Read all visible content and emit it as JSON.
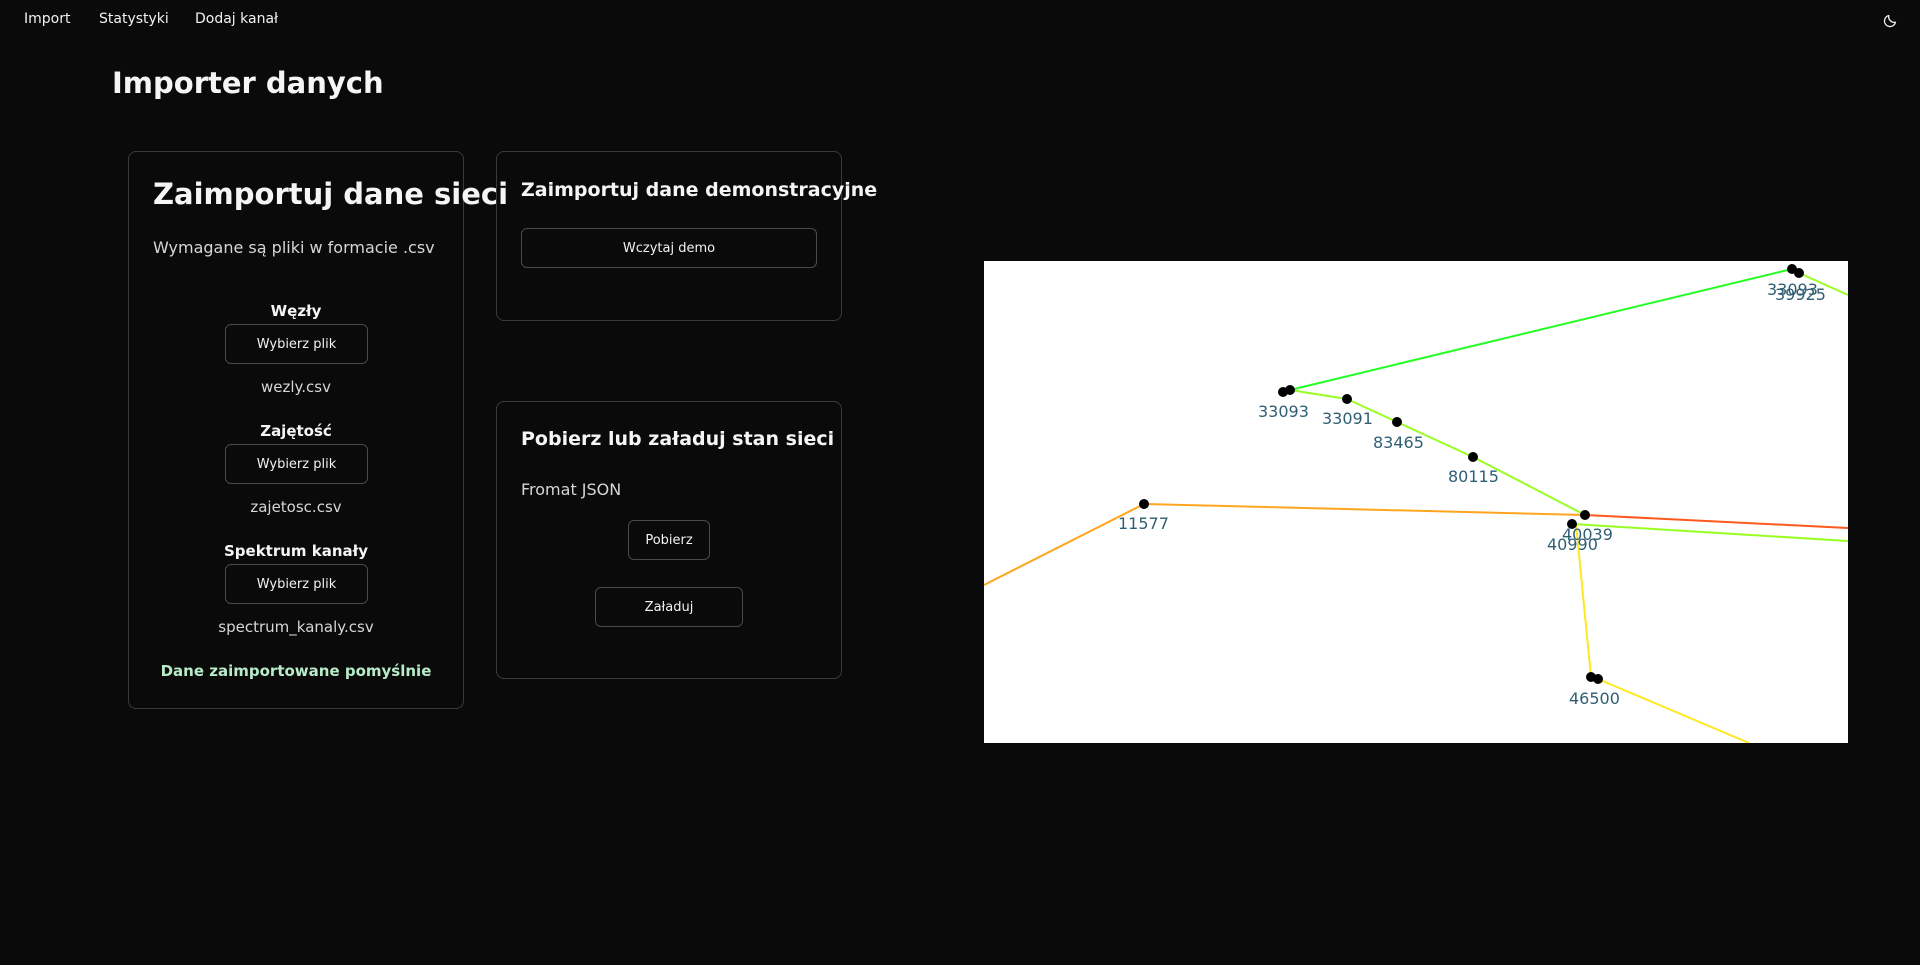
{
  "nav": {
    "items": [
      "Import",
      "Statystyki",
      "Dodaj kanał"
    ],
    "theme_icon": "moon-icon"
  },
  "page": {
    "title": "Importer danych"
  },
  "import_card": {
    "title": "Zaimportuj dane sieci",
    "subtitle": "Wymagane są pliki w formacie .csv",
    "sections": [
      {
        "label": "Węzły",
        "button": "Wybierz plik",
        "filename": "wezly.csv"
      },
      {
        "label": "Zajętość",
        "button": "Wybierz plik",
        "filename": "zajetosc.csv"
      },
      {
        "label": "Spektrum kanały",
        "button": "Wybierz plik",
        "filename": "spectrum_kanaly.csv"
      }
    ],
    "status": "Dane zaimportowane pomyślnie"
  },
  "demo_card": {
    "title": "Zaimportuj dane demonstracyjne",
    "button": "Wczytaj demo"
  },
  "state_card": {
    "title": "Pobierz lub załaduj stan sieci",
    "format": "Fromat JSON",
    "download_button": "Pobierz",
    "load_button": "Załaduj"
  },
  "graph": {
    "edge_colors": {
      "green": "#22ff22",
      "lime": "#99ff22",
      "orange": "#ffa51f",
      "red": "#ff5a1f",
      "yellow": "#ffe81f"
    },
    "node_labels": [
      "33093",
      "33091",
      "83465",
      "80115",
      "11577",
      "40039",
      "40990",
      "46500",
      "39925",
      "33093"
    ]
  }
}
